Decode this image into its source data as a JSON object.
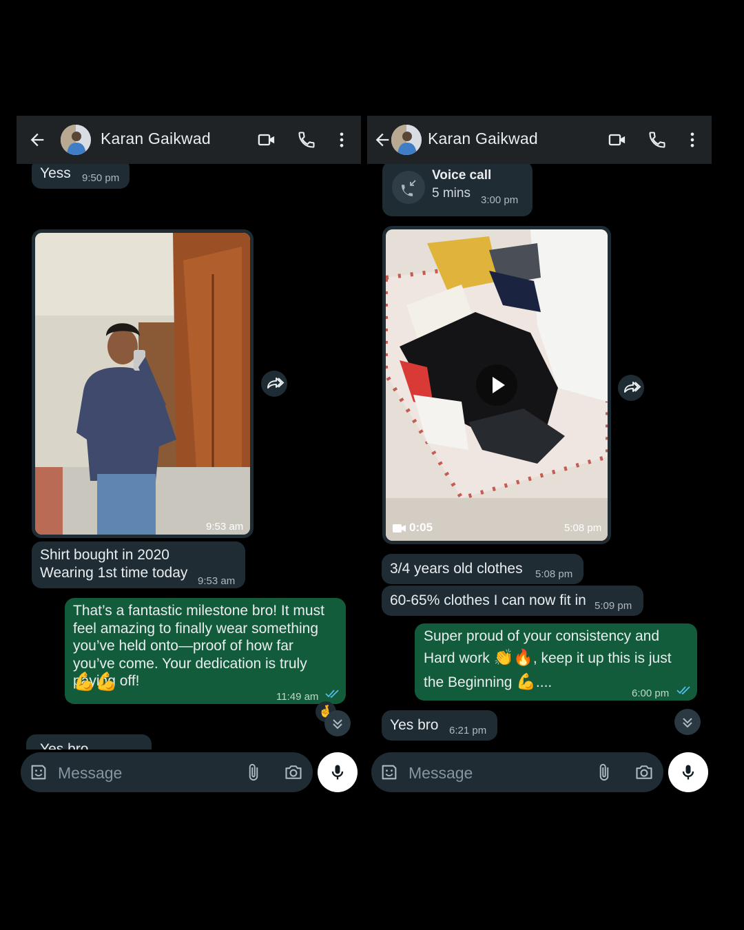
{
  "left": {
    "contact_name": "Karan Gaikwad",
    "messages": {
      "yess": {
        "text": "Yess",
        "time": "9:50 pm"
      },
      "photo": {
        "time": "9:53 am"
      },
      "shirt": {
        "line1": "Shirt bought in 2020",
        "line2": "Wearing 1st time today",
        "time": "9:53 am"
      },
      "reply": {
        "text": "That’s a fantastic milestone bro! It must feel amazing to finally wear something you’ve held onto—proof of how far you’ve come. Your dedication is truly paying off!",
        "emoji": "💪💪",
        "time": "11:49 am"
      },
      "yes_bro_partial": {
        "text": "Yes bro"
      },
      "reaction": "🤞"
    },
    "composer": {
      "placeholder": "Message"
    }
  },
  "right": {
    "contact_name": "Karan Gaikwad",
    "messages": {
      "call": {
        "title": "Voice call",
        "duration": "5 mins",
        "time": "3:00 pm"
      },
      "video": {
        "duration": "0:05",
        "time": "5:08 pm"
      },
      "old_clothes": {
        "text": "3/4 years old clothes",
        "time": "5:08 pm"
      },
      "fit": {
        "text": "60-65% clothes I can now fit in",
        "time": "5:09 pm"
      },
      "proud": {
        "line1": "Super proud of your consistency and",
        "line2a": "Hard work ",
        "line2_emoji": "👏🔥",
        "line2b": ", keep it up this is just",
        "line3a": "the Beginning ",
        "line3_emoji": "💪",
        "line3b": "....",
        "time": "6:00 pm"
      },
      "yes_bro": {
        "text": "Yes bro",
        "time": "6:21 pm"
      }
    },
    "composer": {
      "placeholder": "Message"
    }
  },
  "colors": {
    "incoming_bubble": "#1f2c33",
    "outgoing_bubble": "#125c3b",
    "header": "#1f2326",
    "read_ticks": "#53bdeb"
  },
  "icons": [
    "back-arrow-icon",
    "video-call-icon",
    "phone-icon",
    "more-vert-icon",
    "forward-icon",
    "scroll-down-icon",
    "sticker-icon",
    "attach-icon",
    "camera-icon",
    "mic-icon",
    "incoming-call-icon",
    "play-icon",
    "video-camera-icon",
    "double-tick-icon"
  ]
}
